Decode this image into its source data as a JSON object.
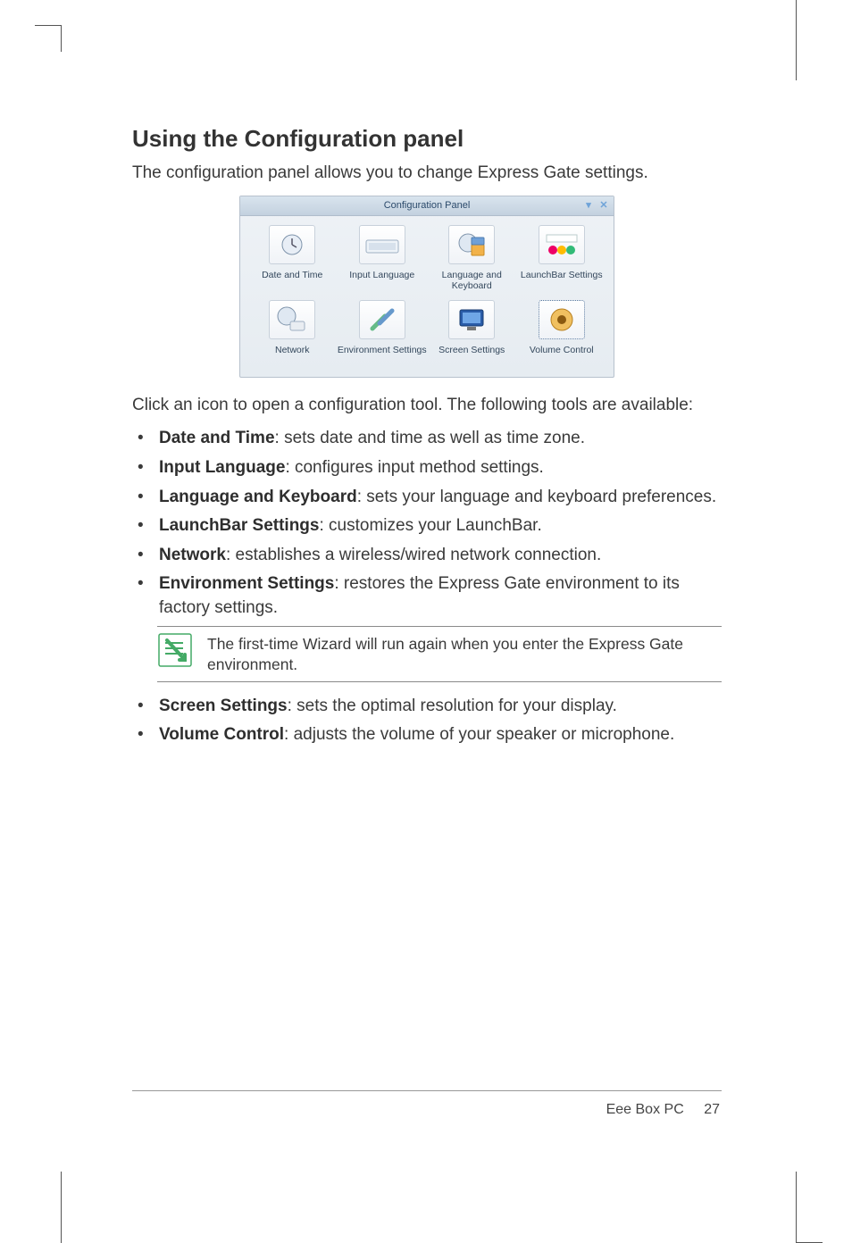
{
  "heading": "Using the Configuration panel",
  "intro": "The configuration panel allows you to change Express Gate settings.",
  "panel": {
    "title": "Configuration Panel",
    "items": [
      {
        "label": "Date and Time",
        "icon": "clock"
      },
      {
        "label": "Input Language",
        "icon": "keyboard"
      },
      {
        "label": "Language and Keyboard",
        "icon": "globe-kb"
      },
      {
        "label": "LaunchBar Settings",
        "icon": "launchbar"
      },
      {
        "label": "Network",
        "icon": "network"
      },
      {
        "label": "Environment Settings",
        "icon": "tools"
      },
      {
        "label": "Screen Settings",
        "icon": "monitor"
      },
      {
        "label": "Volume Control",
        "icon": "speaker",
        "selected": true
      }
    ]
  },
  "afterPanel": "Click an icon to open a configuration tool. The following tools are available:",
  "bullets1": [
    {
      "term": "Date and Time",
      "desc": ": sets date and time as well as time zone."
    },
    {
      "term": "Input Language",
      "desc": ": configures input method settings."
    },
    {
      "term": "Language and Keyboard",
      "desc": ": sets your language and keyboard preferences."
    },
    {
      "term": "LaunchBar Settings",
      "desc": ": customizes your LaunchBar."
    },
    {
      "term": "Network",
      "desc": ": establishes a wireless/wired network connection."
    },
    {
      "term": "Environment Settings",
      "desc": ": restores the Express Gate environment to its factory settings."
    }
  ],
  "note": "The first-time Wizard will run again when you enter the Express Gate environment.",
  "bullets2": [
    {
      "term": "Screen Settings",
      "desc": ": sets the optimal resolution for your display."
    },
    {
      "term": "Volume Control",
      "desc": ": adjusts the volume of your speaker or microphone."
    }
  ],
  "footer": {
    "product": "Eee Box PC",
    "page": "27"
  }
}
